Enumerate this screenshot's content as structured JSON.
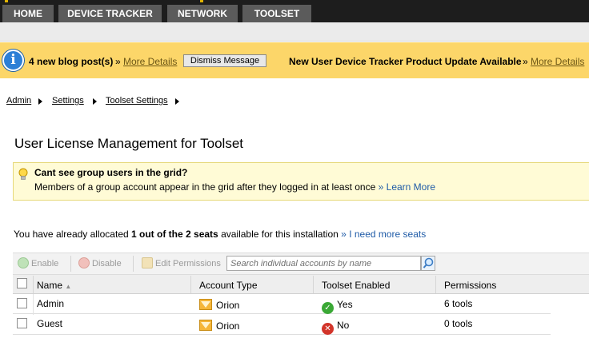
{
  "nav": {
    "tabs": [
      "HOME",
      "DEVICE TRACKER",
      "NETWORK",
      "TOOLSET"
    ]
  },
  "message_bar": {
    "blog_text": "4 new blog post(s)",
    "blog_link": "More Details",
    "dismiss_label": "Dismiss Message",
    "update_text": "New User Device Tracker Product Update Available",
    "update_link": "More Details"
  },
  "breadcrumb": [
    "Admin",
    "Settings",
    "Toolset Settings"
  ],
  "page_title": "User License Management for Toolset",
  "hint": {
    "title": "Cant see group users in the grid?",
    "text": "Members of a group account appear in the grid after they logged in at least once",
    "link": "Learn More"
  },
  "seats": {
    "prefix": "You have already allocated",
    "count": "1 out of the 2 seats",
    "suffix": "available for this installation",
    "link": "I need more seats"
  },
  "toolbar": {
    "enable_label": "Enable",
    "disable_label": "Disable",
    "edit_label": "Edit Permissions",
    "search_placeholder": "Search individual accounts by name"
  },
  "grid": {
    "columns": [
      "Name",
      "Account Type",
      "Toolset Enabled",
      "Permissions"
    ],
    "rows": [
      {
        "name": "Admin",
        "account_type": "Orion",
        "enabled": "Yes",
        "permissions": "6 tools"
      },
      {
        "name": "Guest",
        "account_type": "Orion",
        "enabled": "No",
        "permissions": "0 tools"
      }
    ]
  },
  "colors": {
    "nav_bg": "#1d1d1d",
    "tab_bg": "#5b5b5b",
    "message_bg": "#fcd669",
    "hint_bg": "#fffbd6",
    "link_blue": "#1f5ba7",
    "yes_green": "#3aa835",
    "no_red": "#d2342a"
  }
}
